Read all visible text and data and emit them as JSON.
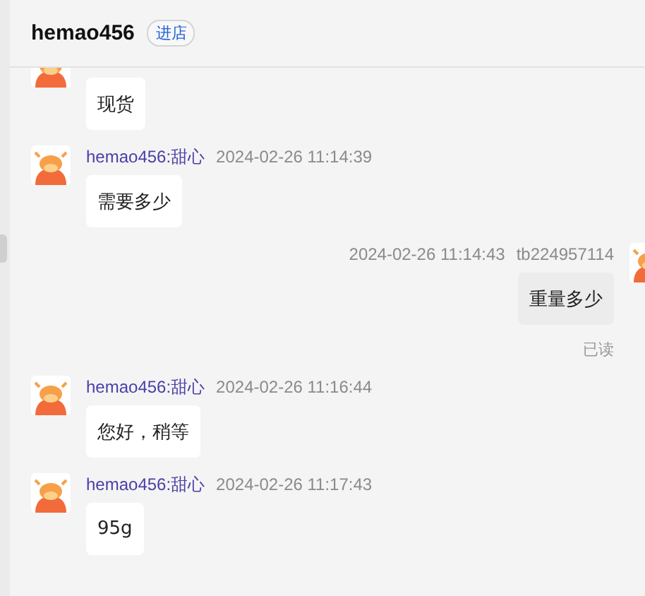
{
  "header": {
    "title": "hemao456",
    "store_link": "进店"
  },
  "messages": [
    {
      "kind": "other",
      "text": "现货"
    },
    {
      "kind": "other",
      "sender": "hemao456:甜心",
      "time": "2024-02-26 11:14:39",
      "text": "需要多少"
    },
    {
      "kind": "self",
      "sender": "tb224957114",
      "time": "2024-02-26 11:14:43",
      "text": "重量多少",
      "status": "已读"
    },
    {
      "kind": "other",
      "sender": "hemao456:甜心",
      "time": "2024-02-26 11:16:44",
      "text": "您好，稍等"
    },
    {
      "kind": "other",
      "sender": "hemao456:甜心",
      "time": "2024-02-26 11:17:43",
      "text": "95g"
    }
  ]
}
